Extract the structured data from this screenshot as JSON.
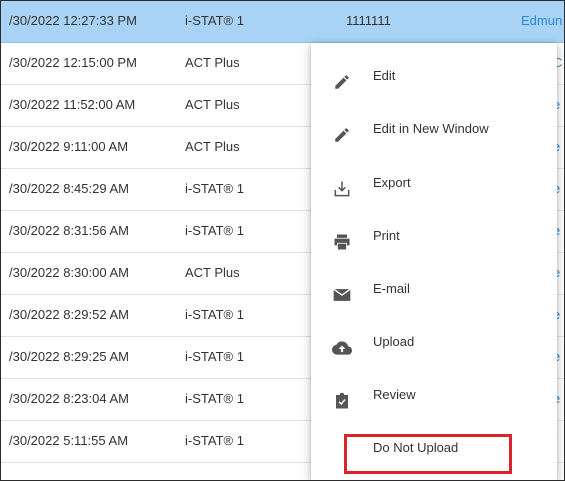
{
  "table": {
    "rows": [
      {
        "date": "/30/2022 12:27:33 PM",
        "device": "i-STAT® 1",
        "id": "1111111",
        "link": "Edmun",
        "selected": true
      },
      {
        "date": "/30/2022 12:15:00 PM",
        "device": "ACT Plus",
        "id": "",
        "link": "C",
        "selected": false
      },
      {
        "date": "/30/2022 11:52:00 AM",
        "device": "ACT Plus",
        "id": "",
        "link": "e",
        "selected": false
      },
      {
        "date": "/30/2022 9:11:00 AM",
        "device": "ACT Plus",
        "id": "",
        "link": "e",
        "selected": false
      },
      {
        "date": "/30/2022 8:45:29 AM",
        "device": "i-STAT® 1",
        "id": "",
        "link": "e",
        "selected": false
      },
      {
        "date": "/30/2022 8:31:56 AM",
        "device": "i-STAT® 1",
        "id": "",
        "link": "e",
        "selected": false
      },
      {
        "date": "/30/2022 8:30:00 AM",
        "device": "ACT Plus",
        "id": "",
        "link": "e",
        "selected": false
      },
      {
        "date": "/30/2022 8:29:52 AM",
        "device": "i-STAT® 1",
        "id": "",
        "link": "e",
        "selected": false
      },
      {
        "date": "/30/2022 8:29:25 AM",
        "device": "i-STAT® 1",
        "id": "",
        "link": "e",
        "selected": false
      },
      {
        "date": "/30/2022 8:23:04 AM",
        "device": "i-STAT® 1",
        "id": "",
        "link": "e",
        "selected": false
      },
      {
        "date": "/30/2022 5:11:55 AM",
        "device": "i-STAT® 1",
        "id": "",
        "link": "r",
        "selected": false
      }
    ]
  },
  "context_menu": {
    "items": [
      {
        "label": "Edit",
        "icon": "pencil-icon"
      },
      {
        "label": "Edit in New Window",
        "icon": "pencil-icon"
      },
      {
        "label": "Export",
        "icon": "export-icon"
      },
      {
        "label": "Print",
        "icon": "printer-icon"
      },
      {
        "label": "E-mail",
        "icon": "envelope-icon"
      },
      {
        "label": "Upload",
        "icon": "cloud-upload-icon"
      },
      {
        "label": "Review",
        "icon": "clipboard-check-icon"
      },
      {
        "label": "Do Not Upload",
        "icon": ""
      }
    ]
  },
  "colors": {
    "selected_row": "#a9d3f5",
    "link": "#2a8ad6",
    "highlight_border": "#d9242b",
    "icon": "#555555"
  }
}
